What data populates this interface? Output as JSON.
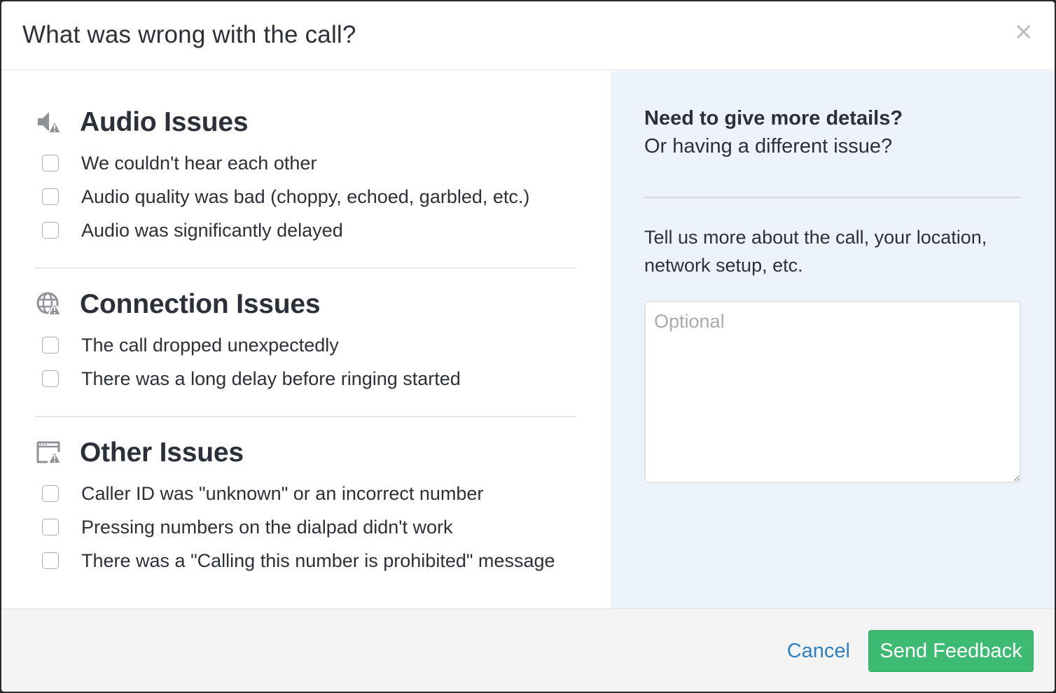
{
  "modal": {
    "title": "What was wrong with the call?",
    "close_label": "×"
  },
  "sections": [
    {
      "title": "Audio Issues",
      "icon": "speaker-warning-icon",
      "options": [
        "We couldn't hear each other",
        "Audio quality was bad (choppy, echoed, garbled, etc.)",
        "Audio was significantly delayed"
      ]
    },
    {
      "title": "Connection Issues",
      "icon": "globe-warning-icon",
      "options": [
        "The call dropped unexpectedly",
        "There was a long delay before ringing started"
      ]
    },
    {
      "title": "Other Issues",
      "icon": "window-warning-icon",
      "options": [
        "Caller ID was \"unknown\" or an incorrect number",
        "Pressing numbers on the dialpad didn't work",
        "There was a \"Calling this number is prohibited\" message"
      ]
    }
  ],
  "details": {
    "title": "Need to give more details?",
    "subtitle": "Or having a different issue?",
    "help": "Tell us more about the call, your location, network setup, etc.",
    "placeholder": "Optional"
  },
  "footer": {
    "cancel_label": "Cancel",
    "send_label": "Send Feedback"
  },
  "colors": {
    "accent_green": "#3dbb73",
    "link_blue": "#2d80c4",
    "side_panel": "#ecf3fb"
  }
}
